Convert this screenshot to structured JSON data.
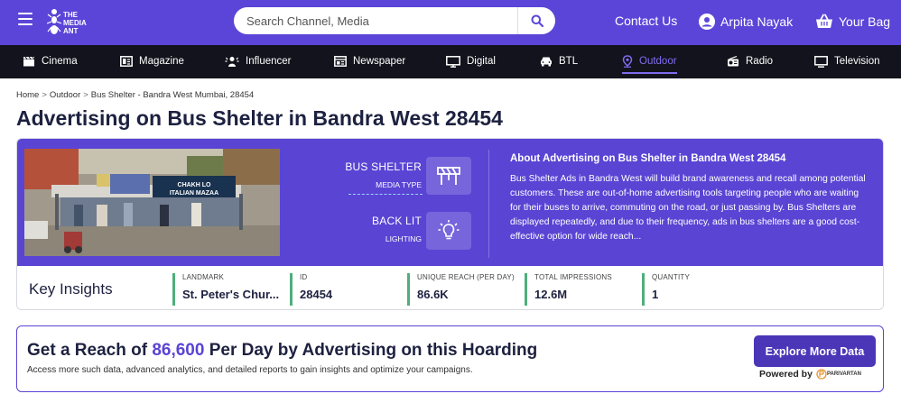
{
  "header": {
    "logo_lines": [
      "THE",
      "MEDIA",
      "ANT"
    ],
    "search_placeholder": "Search Channel, Media",
    "contact_label": "Contact Us",
    "user_name": "Arpita Nayak",
    "bag_label": "Your Bag"
  },
  "categories": [
    {
      "label": "Cinema",
      "icon": "clapper-icon",
      "active": false
    },
    {
      "label": "Magazine",
      "icon": "magazine-icon",
      "active": false
    },
    {
      "label": "Influencer",
      "icon": "influencer-icon",
      "active": false
    },
    {
      "label": "Newspaper",
      "icon": "newspaper-icon",
      "active": false
    },
    {
      "label": "Digital",
      "icon": "monitor-icon",
      "active": false
    },
    {
      "label": "BTL",
      "icon": "car-icon",
      "active": false
    },
    {
      "label": "Outdoor",
      "icon": "location-pin-icon",
      "active": true
    },
    {
      "label": "Radio",
      "icon": "radio-icon",
      "active": false
    },
    {
      "label": "Television",
      "icon": "tv-icon",
      "active": false
    }
  ],
  "breadcrumb": {
    "home": "Home",
    "outdoor": "Outdoor",
    "current": "Bus Shelter - Bandra West Mumbai, 28454",
    "separator": ">"
  },
  "page_title": "Advertising on Bus Shelter in Bandra West 28454",
  "photo_sign": {
    "line1": "CHAKH LO",
    "line2": "ITALIAN MAZAA"
  },
  "features": {
    "media_type_value": "BUS SHELTER",
    "media_type_label": "MEDIA TYPE",
    "lighting_value": "BACK LIT",
    "lighting_label": "LIGHTING"
  },
  "about": {
    "title": "About Advertising on Bus Shelter in Bandra West 28454",
    "text": "Bus Shelter Ads in Bandra West will build brand awareness and recall among potential customers. These are out-of-home advertising tools targeting people who are waiting for their buses to arrive, commuting on the road, or just passing by.  Bus Shelters are displayed repeatedly, and due to their frequency, ads in bus shelters are a good cost-effective option for wide reach..."
  },
  "insights": {
    "title": "Key Insights",
    "items": [
      {
        "label": "LANDMARK",
        "value": "St. Peter's Chur..."
      },
      {
        "label": "ID",
        "value": "28454"
      },
      {
        "label": "UNIQUE REACH (PER DAY)",
        "value": "86.6K"
      },
      {
        "label": "TOTAL IMPRESSIONS",
        "value": "12.6M"
      },
      {
        "label": "QUANTITY",
        "value": "1"
      }
    ]
  },
  "banner": {
    "head_prefix": "Get a Reach of ",
    "head_number": "86,600",
    "head_suffix": " Per Day by Advertising on this Hoarding",
    "subtext": "Access more such data, advanced analytics, and detailed reports to gain insights and optimize your campaigns.",
    "button_label": "Explore More Data",
    "powered_by": "Powered by",
    "brand": "PARIVARTAN"
  },
  "colors": {
    "primary": "#5b45d8",
    "nav_dark": "#12131c",
    "active_nav": "#7f6df0",
    "insight_accent": "#4fae7c"
  }
}
